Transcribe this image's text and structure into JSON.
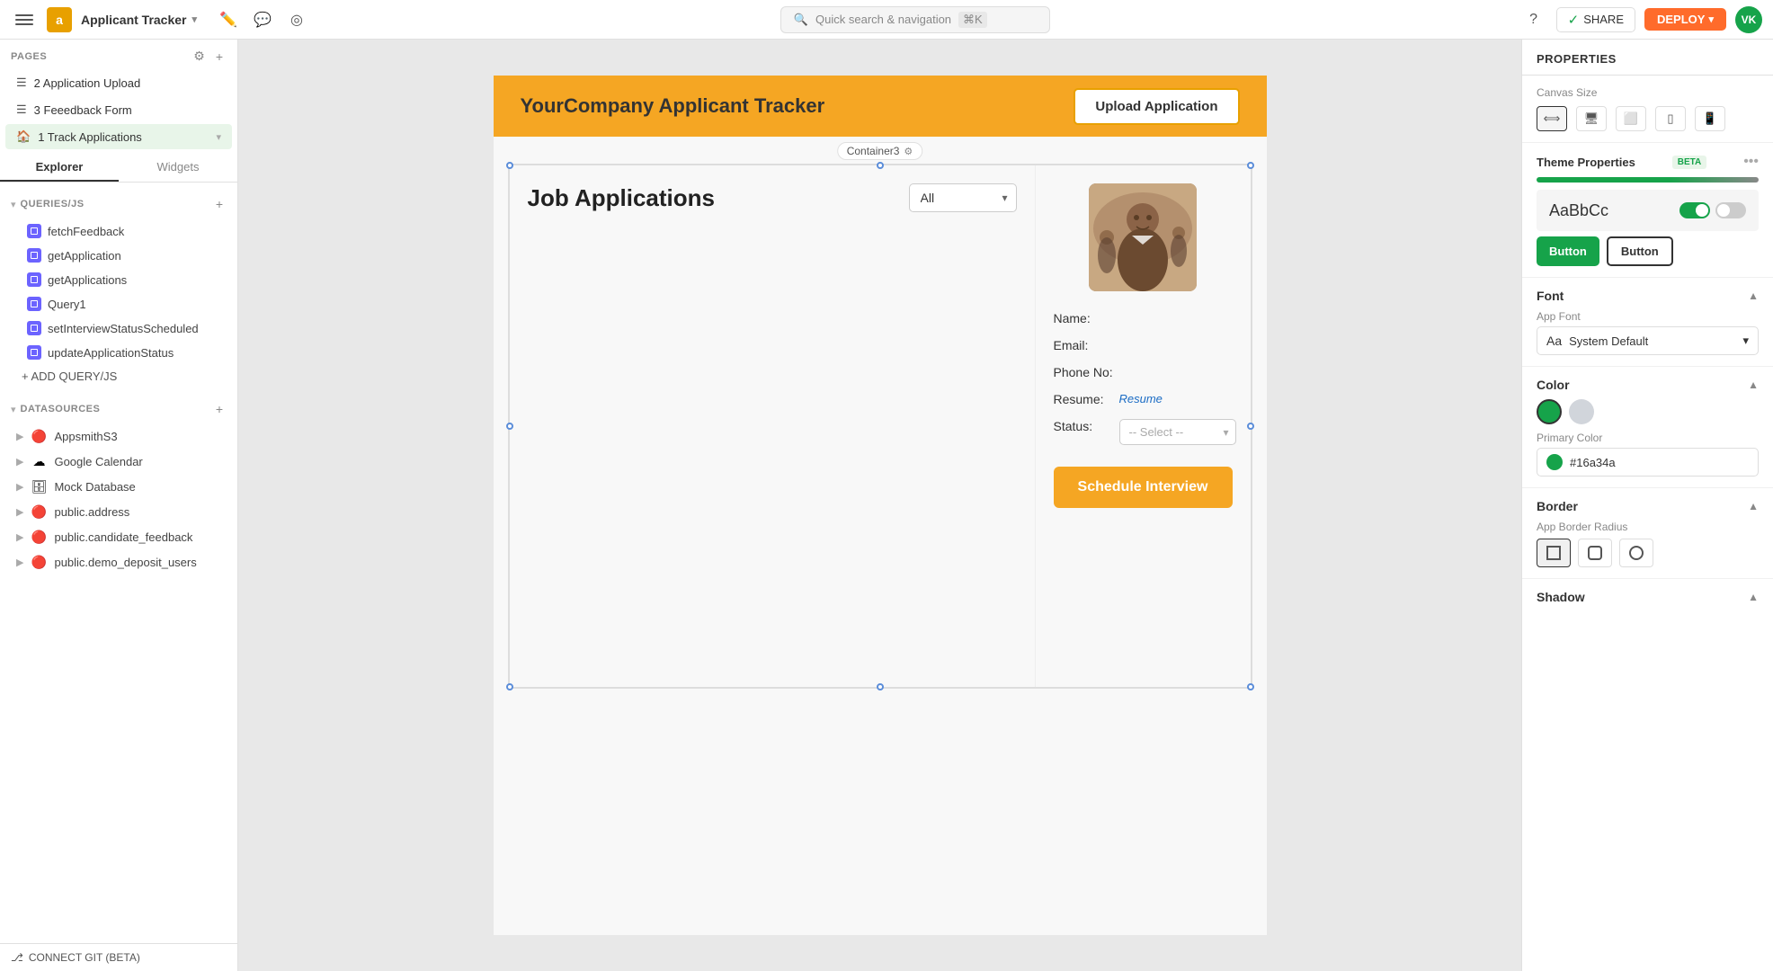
{
  "topbar": {
    "menu_icon": "☰",
    "logo_text": "a",
    "app_title": "Applicant Tracker",
    "chevron": "▾",
    "edit_icon": "✎",
    "comment_icon": "💬",
    "eye_icon": "○",
    "search_placeholder": "Quick search & navigation",
    "search_kbd": "⌘K",
    "help_icon": "?",
    "share_check": "✓",
    "share_label": "SHARE",
    "deploy_label": "DEPLOY",
    "deploy_arrow": "▾",
    "avatar_label": "VK"
  },
  "sidebar": {
    "pages_title": "PAGES",
    "settings_icon": "⚙",
    "add_icon": "+",
    "pages": [
      {
        "icon": "☰",
        "label": "2 Application Upload"
      },
      {
        "icon": "☰",
        "label": "3 Feeedback Form"
      },
      {
        "icon": "🏠",
        "label": "1 Track Applications",
        "active": true,
        "expand": "▾"
      }
    ],
    "tab_explorer": "Explorer",
    "tab_widgets": "Widgets",
    "queries_title": "QUERIES/JS",
    "queries_add": "+",
    "queries": [
      {
        "label": "fetchFeedback"
      },
      {
        "label": "getApplication"
      },
      {
        "label": "getApplications"
      },
      {
        "label": "Query1"
      },
      {
        "label": "setInterviewStatusScheduled"
      },
      {
        "label": "updateApplicationStatus"
      }
    ],
    "add_query_label": "+ ADD QUERY/JS",
    "datasources_title": "DATASOURCES",
    "datasources_add": "+",
    "datasources": [
      {
        "icon": "🔴",
        "label": "AppsmithS3"
      },
      {
        "icon": "☁",
        "label": "Google Calendar"
      },
      {
        "icon": "🗄",
        "label": "Mock Database"
      },
      {
        "icon": "🔴",
        "label": "public.address"
      },
      {
        "icon": "🔴",
        "label": "public.candidate_feedback"
      },
      {
        "icon": "🔴",
        "label": "public.demo_deposit_users"
      }
    ],
    "connect_git": "CONNECT GIT (BETA)"
  },
  "canvas": {
    "app_title": "YourCompany Applicant Tracker",
    "upload_btn": "Upload Application",
    "container_label": "Container3",
    "job_applications_title": "Job Applications",
    "filter_option": "All",
    "name_label": "Name:",
    "email_label": "Email:",
    "phone_label": "Phone No:",
    "resume_label": "Resume:",
    "resume_link": "Resume",
    "status_label": "Status:",
    "status_placeholder": "-- Select --",
    "schedule_btn": "Schedule Interview"
  },
  "properties": {
    "title": "PROPERTIES",
    "canvas_size_title": "Canvas Size",
    "theme_title": "Theme Properties",
    "theme_badge": "BETA",
    "font_preview": "AaBbCc",
    "btn_green": "Button",
    "btn_outline": "Button",
    "font_section_title": "Font",
    "font_label": "App Font",
    "font_value": "System Default",
    "font_aa": "Aa",
    "color_section_title": "Color",
    "primary_color_label": "Primary Color",
    "primary_color_hex": "#16a34a",
    "border_section_title": "Border",
    "border_radius_label": "App Border Radius",
    "shadow_section_title": "Shadow"
  }
}
